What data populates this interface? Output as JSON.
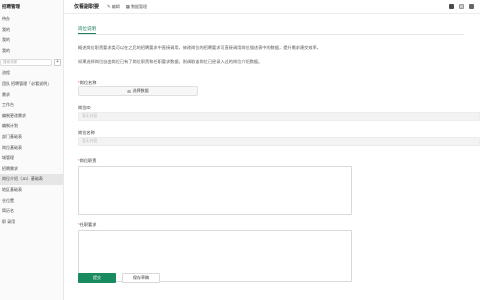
{
  "sidebar": {
    "title": "招聘管理",
    "items_top": [
      "待办",
      "我的",
      "我的",
      "我的"
    ],
    "search_placeholder": "搜索流程",
    "items": [
      "流程",
      "团队 招聘管理「必看说明」",
      "需求",
      "工作台",
      "编制更改需求",
      "编制计划",
      "部门基础表",
      "岗位基础表",
      "城管理",
      "招聘需求",
      "岗位介绍（JD）基础表",
      "地区基础表",
      "仓位置",
      "简历名",
      "职 录用"
    ],
    "active_index": 10
  },
  "topbar": {
    "page_name": "仅看副职要",
    "edit_label": "编辑",
    "manage_label": "数据管理"
  },
  "main": {
    "section_tab": "岗位说明",
    "desc_1": "概述岗位职责要求类可以在之后的招聘要求中直接调用，修改岗位的招聘要求可直接调用岗位描述表中的数据，提升需求建交效率。",
    "desc_2": "如果选择岗位自由岗位已有了岗位职责和任职要求数据，则调取该岗位已经录入过的岗位介绍数据。",
    "field_position_label": "岗位名称",
    "select_data_label": "选择数据",
    "field_id_label": "岗位ID",
    "field_id_placeholder": "暂无内容",
    "field_name_label": "岗位名称",
    "field_name_placeholder": "暂无内容",
    "field_duties_label": "岗位职责",
    "field_requirements_label": "任职要求",
    "submit_label": "提交",
    "draft_label": "保存草稿"
  }
}
